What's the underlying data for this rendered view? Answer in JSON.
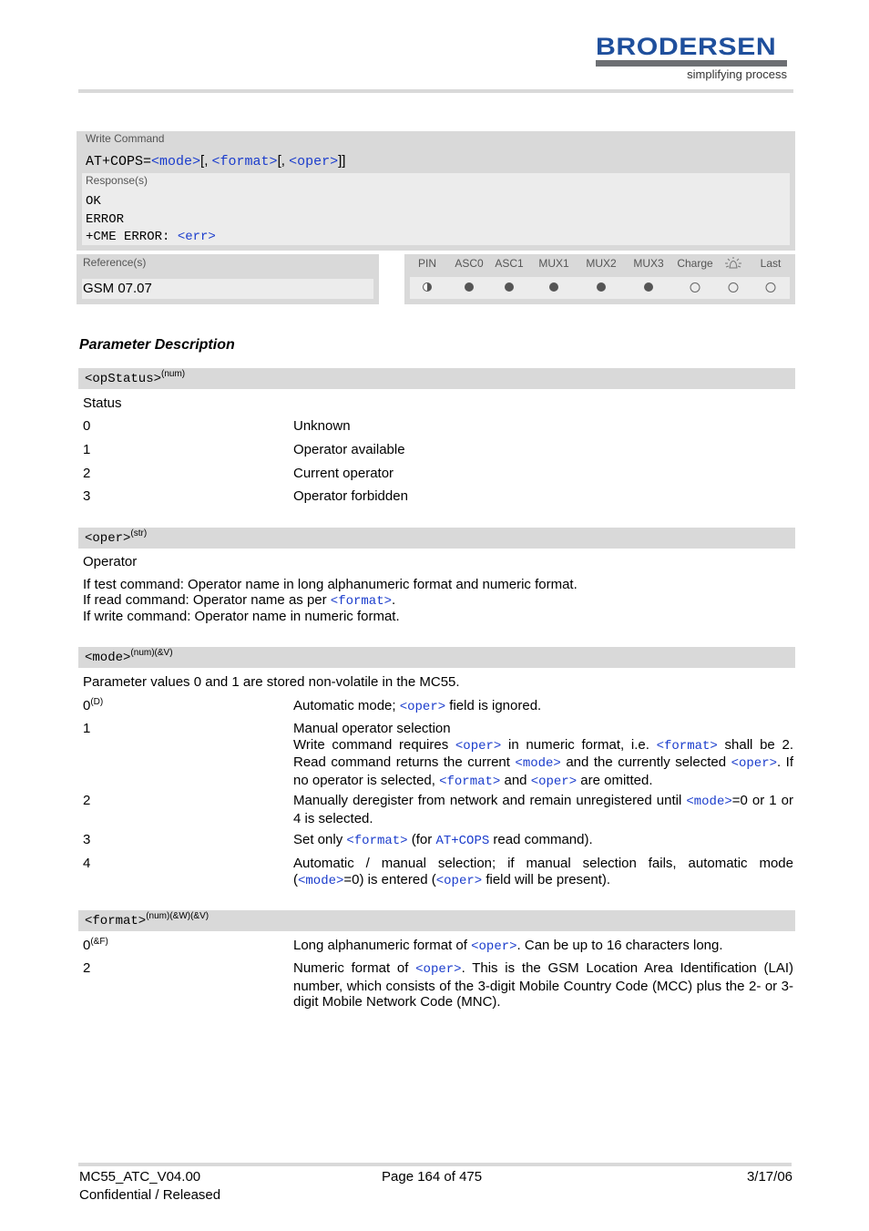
{
  "header": {
    "logo_text": "BRODERSEN",
    "logo_tagline": "simplifying process",
    "brand_color": "#1f4f9c"
  },
  "write_command": {
    "label": "Write Command",
    "syntax_prefix": "AT+COPS=",
    "syntax_params": [
      "<mode>",
      "<format>",
      "<oper>"
    ],
    "syntax_sep1": "[, ",
    "syntax_sep2": "[, ",
    "syntax_suffix": "]]",
    "responses_label": "Response(s)",
    "responses": [
      "OK",
      "ERROR",
      "+CME ERROR: "
    ],
    "response_err_param": "<err>"
  },
  "reference": {
    "label": "Reference(s)",
    "value": "GSM 07.07"
  },
  "support_matrix": {
    "columns": [
      "PIN",
      "ASC0",
      "ASC1",
      "MUX1",
      "MUX2",
      "MUX3",
      "Charge",
      "alarm-icon",
      "Last"
    ],
    "states": [
      "half",
      "full",
      "full",
      "full",
      "full",
      "full",
      "empty",
      "empty",
      "empty"
    ]
  },
  "section_title": "Parameter Description",
  "params": {
    "opStatus": {
      "name": "<opStatus>",
      "type": "(num)",
      "description": "Status",
      "values": [
        {
          "value": "0",
          "text": "Unknown"
        },
        {
          "value": "1",
          "text": "Operator available"
        },
        {
          "value": "2",
          "text": "Current operator"
        },
        {
          "value": "3",
          "text": "Operator forbidden"
        }
      ]
    },
    "oper": {
      "name": "<oper>",
      "type": "(str)",
      "description": "Operator",
      "line1": "If test command: Operator name in long alphanumeric format and numeric format.",
      "line2_prefix": "If read command: Operator name as per ",
      "line2_link": "<format>",
      "line2_suffix": ".",
      "line3": "If write command: Operator name in numeric format."
    },
    "mode": {
      "name": "<mode>",
      "type": "(num)(&V)",
      "note": "Parameter values 0 and 1 are stored non-volatile in the MC55.",
      "v0": {
        "value": "0",
        "sup": "(D)",
        "t1": "Automatic mode; ",
        "l1": "<oper>",
        "t2": " field is ignored."
      },
      "v1": {
        "value": "1",
        "line1": "Manual operator selection",
        "t1": "Write command requires ",
        "l1": "<oper>",
        "t2": " in numeric format, i.e. ",
        "l2": "<format>",
        "t3": " shall be 2. Read command returns the current ",
        "l3": "<mode>",
        "t4": " and the currently selected ",
        "l4": "<oper>",
        "t5": ". If no operator is selected, ",
        "l5": "<format>",
        "t6": " and ",
        "l6": "<oper>",
        "t7": " are omitted."
      },
      "v2": {
        "value": "2",
        "t1": "Manually deregister from network and remain unregistered until ",
        "l1": "<mode>",
        "t2": "=0 or 1 or 4 is selected."
      },
      "v3": {
        "value": "3",
        "t1": "Set only ",
        "l1": "<format>",
        "t2": " (for ",
        "l2": "AT+COPS",
        "t3": " read command)."
      },
      "v4": {
        "value": "4",
        "t1": "Automatic / manual selection; if manual selection fails, automatic mode (",
        "l1": "<mode>",
        "t2": "=0) is entered (",
        "l2": "<oper>",
        "t3": " field will be present)."
      }
    },
    "format": {
      "name": "<format>",
      "type": "(num)(&W)(&V)",
      "v0": {
        "value": "0",
        "sup": "(&F)",
        "t1": "Long alphanumeric format of ",
        "l1": "<oper>",
        "t2": ". Can be up to 16 characters long."
      },
      "v2": {
        "value": "2",
        "t1": "Numeric format of ",
        "l1": "<oper>",
        "t2": ". This is the GSM Location Area Identification (LAI) number, which consists of the 3-digit Mobile Country Code (MCC) plus the 2- or 3-digit Mobile Network Code (MNC)."
      }
    }
  },
  "footer": {
    "doc_id": "MC55_ATC_V04.00",
    "status": "Confidential / Released",
    "page": "Page 164 of 475",
    "date": "3/17/06"
  }
}
